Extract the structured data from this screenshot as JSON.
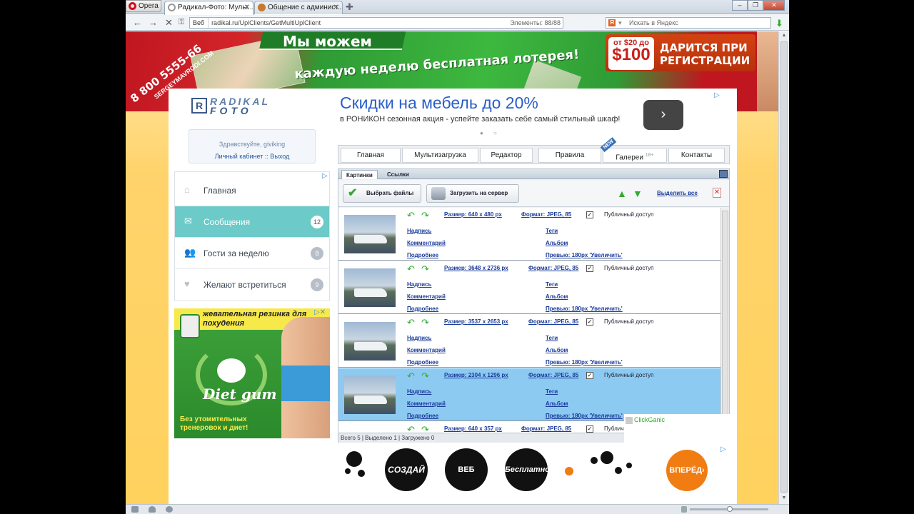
{
  "browser": {
    "opera_label": "Opera",
    "tabs": [
      {
        "title": "Радикал-Фото: Мульт...",
        "active": true
      },
      {
        "title": "Общение с админист...",
        "active": false
      }
    ],
    "address_web": "Веб",
    "url": "radikal.ru/UplClients/GetMultiUplClient",
    "elements_label": "Элементы:",
    "elements_count": "88/88",
    "search_placeholder": "Искать в Яндекс"
  },
  "banner": {
    "slogan": "Мы можем",
    "phone": "8 800 5555-66",
    "site": "SERGEYMAVRODI.COM",
    "weekly": "каждую неделю бесплатная лотерея!",
    "price_small": "от $20 до",
    "price_big": "$100",
    "gift": "ДАРИТСЯ ПРИ РЕГИСТРАЦИИ"
  },
  "logo": {
    "t1": "RADIKAL",
    "t2": "FOTO"
  },
  "greeting": {
    "hello": "Здравствуйте, giviking",
    "cabinet": "Личный кабинет",
    "sep": "::",
    "logout": "Выход"
  },
  "ad_top": {
    "headline": "Скидки на мебель до 20%",
    "desc": "в РОНИКОН сезонная акция - успейте заказать себе самый стильный шкаф!",
    "go": "›"
  },
  "menu": [
    {
      "label": "Главная"
    },
    {
      "label": "Мультизагрузка"
    },
    {
      "label": "Редактор"
    },
    {
      "label": "Правила"
    },
    {
      "label": "Галереи",
      "sup": "18+"
    },
    {
      "label": "Контакты"
    }
  ],
  "menu_new_badge": "NEW",
  "left_menu": [
    {
      "label": "Главная",
      "icon": "home-icon",
      "glyph": "⌂",
      "badge": ""
    },
    {
      "label": "Сообщения",
      "icon": "mail-icon",
      "glyph": "✉",
      "badge": "12"
    },
    {
      "label": "Гости за неделю",
      "icon": "guests-icon",
      "glyph": "👥",
      "badge": "8"
    },
    {
      "label": "Желают встретиться",
      "icon": "heart-icon",
      "glyph": "♥",
      "badge": "9"
    }
  ],
  "diet_ad": {
    "head": "жевательная резинка для похудения",
    "brand": "Diet gum",
    "note1": "Без утомительных",
    "note2": "тренеровок и диет!"
  },
  "uploader": {
    "tabs": [
      "Картинки",
      "Ссылки"
    ],
    "choose_files": "Выбрать файлы",
    "upload": "Загрузить на сервер",
    "select_all": "Выделить все",
    "rows": [
      {
        "size": "Размер: 640 x 480 px",
        "format": "Формат: JPEG, 85",
        "selected": false
      },
      {
        "size": "Размер: 3648 x 2736 px",
        "format": "Формат: JPEG, 85",
        "selected": false
      },
      {
        "size": "Размер: 3537 x 2653 px",
        "format": "Формат: JPEG, 85",
        "selected": false
      },
      {
        "size": "Размер: 2304 x 1296 px",
        "format": "Формат: JPEG, 85",
        "selected": true
      },
      {
        "size": "Размер: 640 x 357 px",
        "format": "Формат: JPEG, 85",
        "selected": false
      }
    ],
    "public_access": "Публичный доступ",
    "public_access_short": "Публичн",
    "caption": "Надпись",
    "comment": "Комментарий",
    "more": "Подробнее",
    "tags": "Теги",
    "album": "Альбом",
    "preview": "Превью: 180px 'Увеличить'",
    "status": "Всего 5 | Выделено 1 | Загружено 0"
  },
  "clickganic": "ClickGanic",
  "bottom_ad": {
    "c1": "СОЗДАЙ",
    "c2": "ВЕБ САЙТЫ",
    "c3": "Бесплатно",
    "c4": "ВПЕРЁД›"
  }
}
